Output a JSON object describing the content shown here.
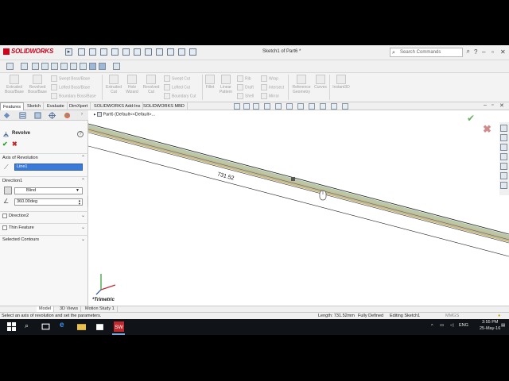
{
  "app": {
    "logo_text": "SOLIDWORKS",
    "document_title": "Sketch1 of Part6 *",
    "search_placeholder": "Search Commands"
  },
  "ribbon": {
    "items": [
      {
        "label": "Extruded\nBoss/Base"
      },
      {
        "label": "Revolved\nBoss/Base"
      },
      {
        "label": "Swept Boss/Base"
      },
      {
        "label": "Lofted Boss/Base"
      },
      {
        "label": "Boundary Boss/Base"
      },
      {
        "label": "Extruded\nCut"
      },
      {
        "label": "Hole\nWizard"
      },
      {
        "label": "Revolved\nCut"
      },
      {
        "label": "Swept Cut"
      },
      {
        "label": "Lofted Cut"
      },
      {
        "label": "Boundary Cut"
      },
      {
        "label": "Fillet"
      },
      {
        "label": "Linear\nPattern"
      },
      {
        "label": "Rib"
      },
      {
        "label": "Draft"
      },
      {
        "label": "Shell"
      },
      {
        "label": "Wrap"
      },
      {
        "label": "Intersect"
      },
      {
        "label": "Mirror"
      },
      {
        "label": "Reference\nGeometry"
      },
      {
        "label": "Curves"
      },
      {
        "label": "Instant3D"
      }
    ]
  },
  "tabs": [
    "Features",
    "Sketch",
    "Evaluate",
    "DimXpert",
    "SOLIDWORKS Add-Ins",
    "SOLIDWORKS MBD"
  ],
  "property_manager": {
    "title": "Revolve",
    "help": "?",
    "ok_symbol": "✔",
    "cancel_symbol": "✖",
    "axis_section": "Axis of Revolution",
    "axis_value": "Line1",
    "direction1_section": "Direction1",
    "direction_type": "Blind",
    "angle_value": "360.00deg",
    "direction2_section": "Direction2",
    "thin_feature_section": "Thin Feature",
    "selected_contours_section": "Selected Contours"
  },
  "viewport": {
    "tree_item": "Part6  (Default<<Default>...",
    "dimension_value": "731.52",
    "view_label": "*Trimetric"
  },
  "model_tabs": [
    "Model",
    "3D Views",
    "Motion Study 1"
  ],
  "status_bar": {
    "message": "Select an axis of revolution and set the parameters.",
    "length": "Length: 731.52mm",
    "definition": "Fully Defined",
    "editing": "Editing Sketch1",
    "units": "MMGS"
  },
  "taskbar": {
    "language": "ENG",
    "time": "3:55 PM",
    "date": "25-May-16"
  },
  "colors": {
    "accent_blue": "#3a7ad8",
    "solidworks_red": "#d0021b",
    "ok_green": "#2a9a2a",
    "cancel_red": "#c0282d"
  }
}
